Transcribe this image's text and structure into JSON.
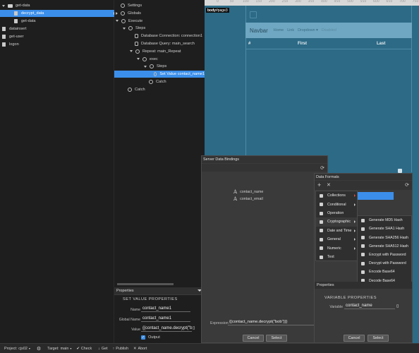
{
  "file_tree": {
    "items": [
      {
        "label": "get-data",
        "indent": 0,
        "kind": "folder-open"
      },
      {
        "label": "decrypt_data",
        "indent": 1,
        "kind": "file",
        "selected": true
      },
      {
        "label": "get-data",
        "indent": 1,
        "kind": "file"
      },
      {
        "label": "datainsert",
        "indent": 0,
        "kind": "file"
      },
      {
        "label": "get-user",
        "indent": 0,
        "kind": "file"
      },
      {
        "label": "logon",
        "indent": 0,
        "kind": "file"
      }
    ]
  },
  "steps_tree": {
    "items": [
      {
        "label": "Settings",
        "indent": 0,
        "icon": "gear"
      },
      {
        "label": "Globals",
        "indent": 0,
        "icon": "arrow",
        "arrow": true
      },
      {
        "label": "Execute",
        "indent": 0,
        "icon": "gear",
        "open": true
      },
      {
        "label": "Steps",
        "indent": 1,
        "icon": "gear",
        "open": true
      },
      {
        "label": "Database Connection: connection1",
        "indent": 2,
        "icon": "db"
      },
      {
        "label": "Database Query: main_search",
        "indent": 2,
        "icon": "db"
      },
      {
        "label": "Repeat: main_Repeat",
        "indent": 2,
        "icon": "repeat",
        "open": true
      },
      {
        "label": "exec",
        "indent": 3,
        "icon": "gear",
        "open": true
      },
      {
        "label": "Steps",
        "indent": 4,
        "icon": "gear",
        "open": true
      },
      {
        "label": "Set Value contact_name1",
        "indent": 5,
        "icon": "gear",
        "selected": true
      },
      {
        "label": "Catch",
        "indent": 4,
        "icon": "gear"
      },
      {
        "label": "Catch",
        "indent": 1,
        "icon": "gear"
      }
    ]
  },
  "canvas": {
    "body_tag": "body",
    "body_tag_page": "#page3",
    "ruler_ticks": [
      "0",
      "50",
      "100",
      "150",
      "200",
      "250",
      "300",
      "350",
      "400",
      "450",
      "500",
      "550",
      "600",
      "650",
      "700",
      "750"
    ],
    "navbar": {
      "brand": "Navbar",
      "links": [
        "Home",
        "Link",
        "Dropdown ▾",
        "Disabled"
      ]
    },
    "table_headers": [
      "#",
      "First",
      "Last"
    ]
  },
  "properties_panel": {
    "header": "Properties",
    "section_title": "SET VALUE PROPERTIES",
    "name_label": "Name",
    "name_value": "contact_name1",
    "global_name_label": "Global Name",
    "global_name_value": "contact_name1",
    "value_label": "Value",
    "value_value": "{{contact_name.decrypt(\"bo",
    "output_label": "Output",
    "output_checked": true
  },
  "server_bindings_dialog": {
    "title": "Server Data Bindings",
    "bindings": [
      "contact_name",
      "contact_email"
    ],
    "expression_label": "Expression",
    "expression_value": "{{contact_name.decrypt(\"bob\")}}",
    "cancel_label": "Cancel",
    "select_label": "Select"
  },
  "data_formats_dialog": {
    "title": "Data Formats",
    "menu": [
      "Collections",
      "Conditional",
      "Operation",
      "Cryptographic",
      "Date and Time",
      "General",
      "Numeric",
      "Text"
    ],
    "menu_has_arrow": [
      true,
      true,
      false,
      true,
      true,
      true,
      true,
      false
    ],
    "crypto_submenu": [
      "Generate MD5 Hash",
      "Generate SHA1 Hash",
      "Generate SHA256 Hash",
      "Generate SHA512 Hash",
      "Encrypt with Password",
      "Decrypt with Password",
      "Encode Base64",
      "Decode Base64"
    ],
    "properties_header": "Properties",
    "variable_section_title": "VARIABLE PROPERTIES",
    "variable_label": "Variable",
    "variable_value": "contact_name",
    "cancel_label": "Cancel",
    "select_label": "Select"
  },
  "status_bar": {
    "project_label": "Project:",
    "project_value": "cjs02",
    "target_label": "Target:",
    "target_value": "main",
    "check_label": "Check",
    "get_label": "Get",
    "publish_label": "Publish",
    "abort_label": "Abort"
  },
  "colors": {
    "selection": "#3b8fea",
    "canvas_bg": "#2c6a86",
    "navbar_bg": "#6fa6c1",
    "panel_bg": "#1e1e1e",
    "dialog_bg": "#3a3a3a"
  }
}
